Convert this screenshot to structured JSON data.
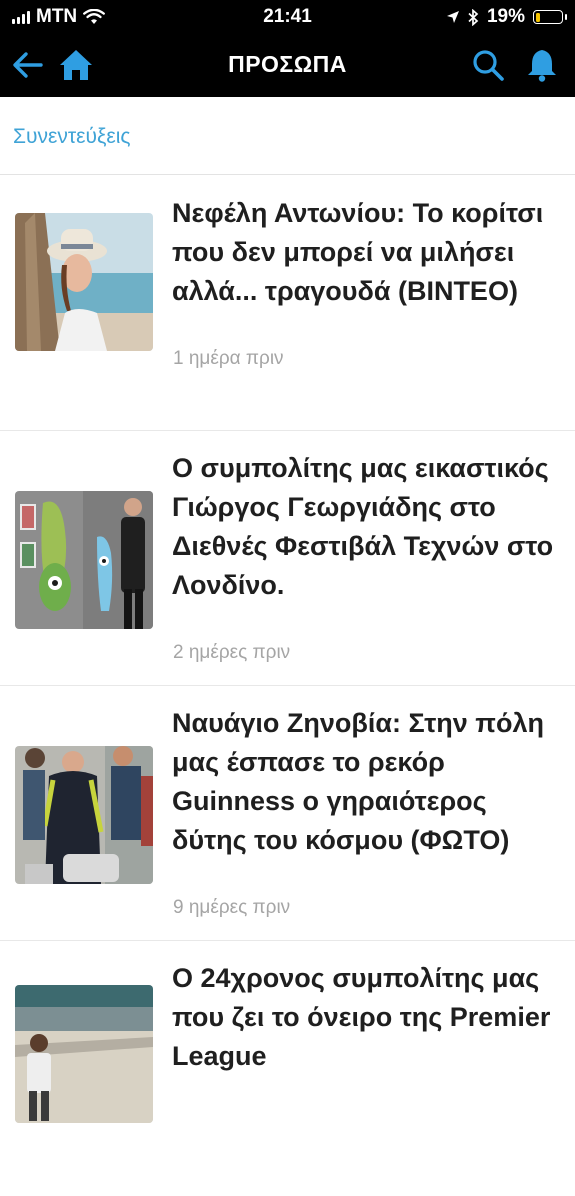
{
  "status_bar": {
    "carrier": "MTN",
    "time": "21:41",
    "battery_percent": "19%",
    "battery_level": 0.19,
    "icons": [
      "signal-bars-icon",
      "wifi-icon",
      "location-arrow-icon",
      "bluetooth-icon",
      "battery-icon"
    ]
  },
  "nav": {
    "title": "ΠΡΟΣΩΠΑ",
    "accent_color": "#2f9ee2",
    "icons": [
      "back-arrow-icon",
      "home-icon",
      "search-icon",
      "bell-icon"
    ]
  },
  "category": {
    "label": "Συνεντεύξεις",
    "color": "#3fa3d6"
  },
  "articles": [
    {
      "headline": "Νεφέλη Αντωνίου: Το κορίτσι που δεν μπορεί να μιλήσει αλλά... τραγουδά (ΒΙΝΤΕΟ)",
      "time": "1 ημέρα πριν"
    },
    {
      "headline": "Ο συμπολίτης μας εικαστικός Γιώργος Γεωργιάδης στο Διεθνές Φεστιβάλ Τεχνών στο Λονδίνο.",
      "time": "2 ημέρες πριν"
    },
    {
      "headline": "Ναυάγιο Ζηνοβία: Στην πόλη μας έσπασε το ρεκόρ Guinness ο γηραιότερος δύτης του κόσμου (ΦΩΤΟ)",
      "time": "9 ημέρες πριν"
    },
    {
      "headline": "Ο 24χρονος συμπολίτης μας που ζει το όνειρο της Premier League",
      "time": ""
    }
  ]
}
